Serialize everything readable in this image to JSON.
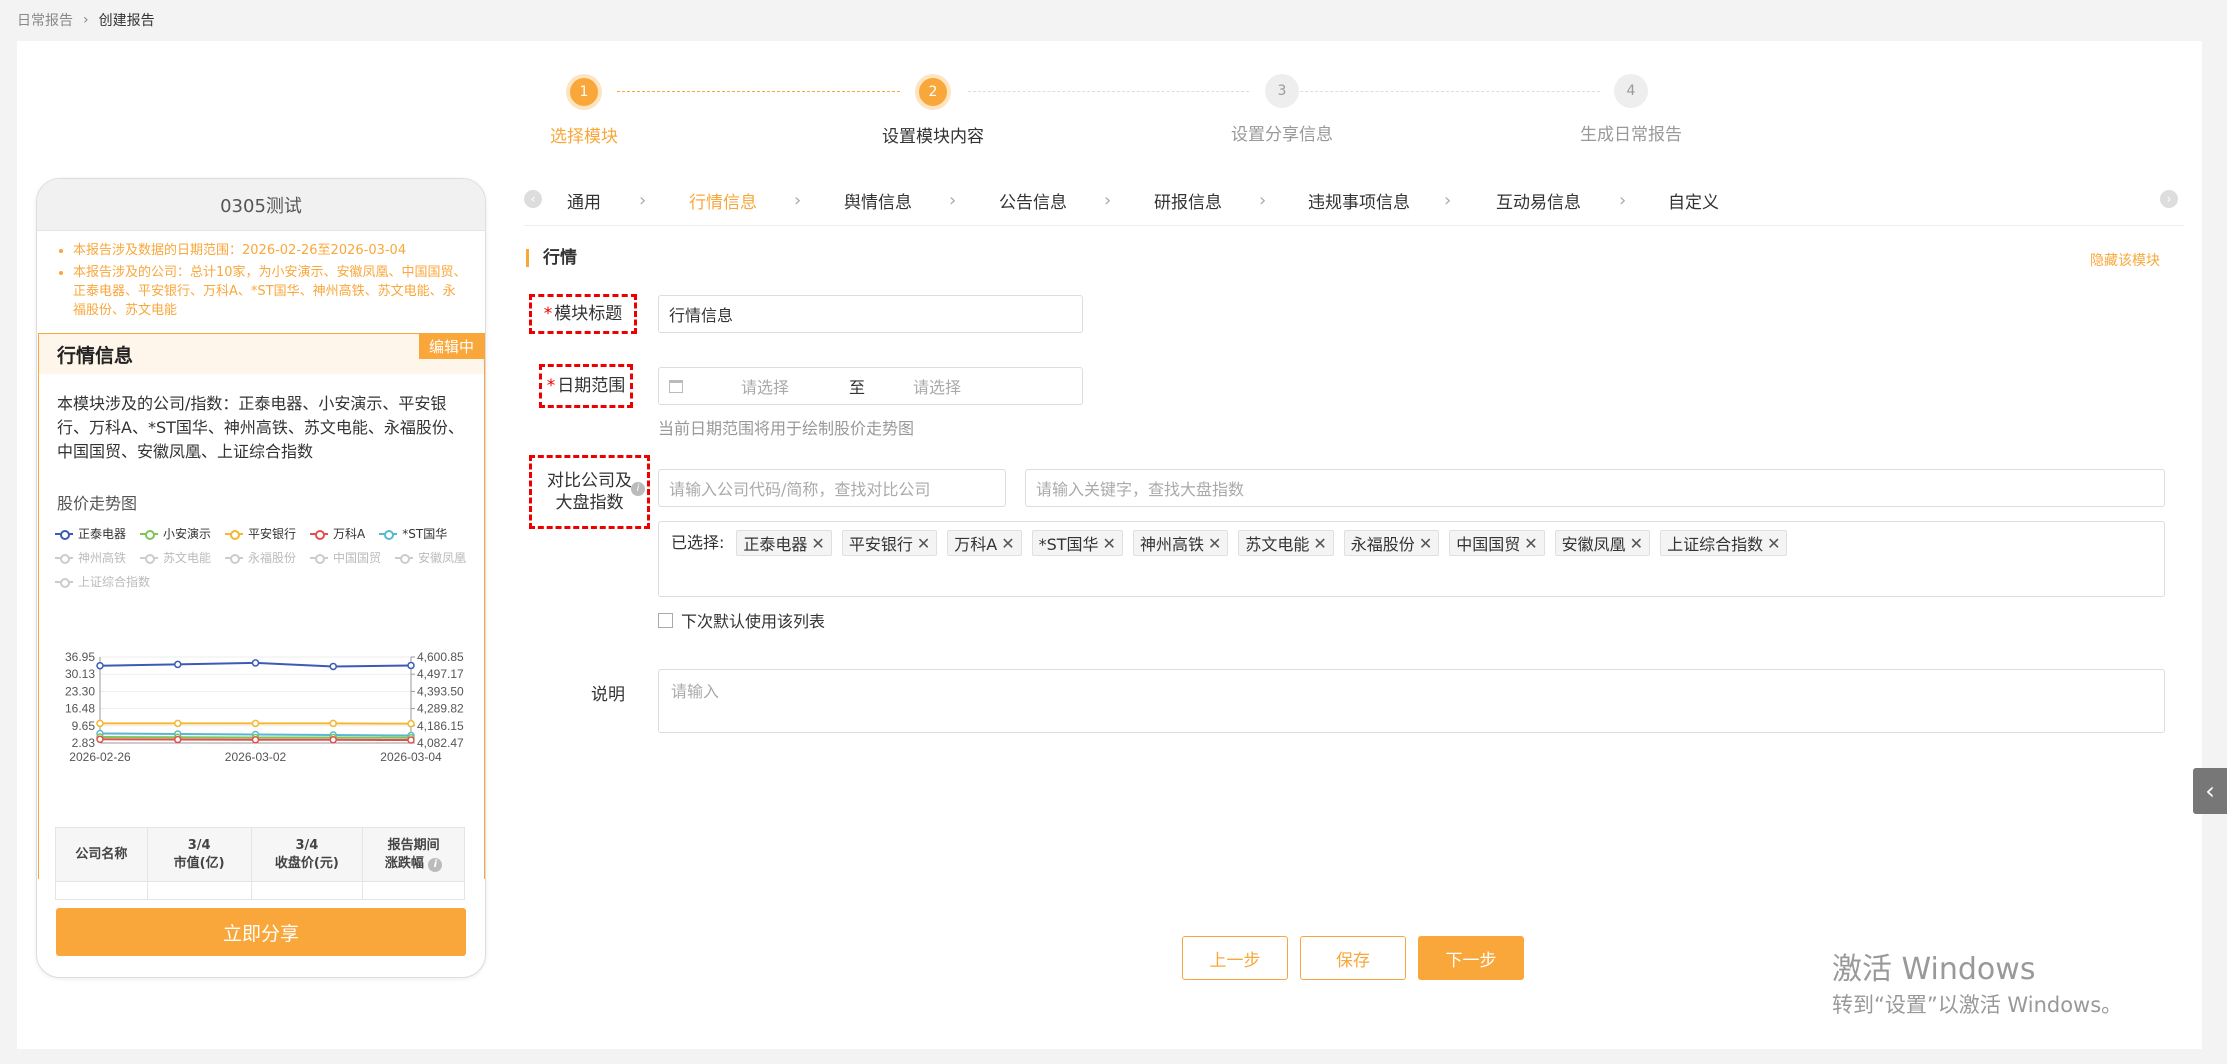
{
  "breadcrumb": {
    "home": "日常报告",
    "current": "创建报告"
  },
  "steps": [
    {
      "num": "1",
      "label": "选择模块"
    },
    {
      "num": "2",
      "label": "设置模块内容"
    },
    {
      "num": "3",
      "label": "设置分享信息"
    },
    {
      "num": "4",
      "label": "生成日常报告"
    }
  ],
  "preview": {
    "title": "0305测试",
    "notes": [
      "本报告涉及数据的日期范围：2026-02-26至2026-03-04",
      "本报告涉及的公司：总计10家，为小安演示、安徽凤凰、中国国贸、正泰电器、平安银行、万科A、*ST国华、神州高铁、苏文电能、永福股份、苏文电能"
    ],
    "module_title": "行情信息",
    "badge": "编辑中",
    "module_desc": "本模块涉及的公司/指数：正泰电器、小安演示、平安银行、万科A、*ST国华、神州高铁、苏文电能、永福股份、中国国贸、安徽凤凰、上证综合指数",
    "chart_title": "股价走势图",
    "legend_active": [
      {
        "name": "正泰电器",
        "color": "#3b5bb5"
      },
      {
        "name": "小安演示",
        "color": "#7fc45a"
      },
      {
        "name": "平安银行",
        "color": "#f5b731"
      },
      {
        "name": "万科A",
        "color": "#e2504e"
      },
      {
        "name": "*ST国华",
        "color": "#57b8d1"
      }
    ],
    "legend_inactive": [
      "神州高铁",
      "苏文电能",
      "永福股份",
      "中国国贸",
      "安徽凤凰",
      "上证综合指数"
    ],
    "table_headers": [
      "公司名称",
      "3/4\n市值(亿)",
      "3/4\n收盘价(元)",
      "报告期间\n涨跌幅"
    ],
    "share_label": "立即分享"
  },
  "chart_data": {
    "type": "line",
    "x": [
      "2026-02-26",
      "2026-02-27",
      "2026-03-02",
      "2026-03-03",
      "2026-03-04"
    ],
    "x_tick_labels": [
      "2026-02-26",
      "2026-03-02",
      "2026-03-04"
    ],
    "y_left_ticks": [
      "36.95",
      "30.13",
      "23.30",
      "16.48",
      "9.65",
      "2.83"
    ],
    "y_right_ticks": [
      "4,600.85",
      "4,497.17",
      "4,393.50",
      "4,289.82",
      "4,186.15",
      "4,082.47"
    ],
    "ylim": [
      2.83,
      36.95
    ],
    "grid": true,
    "series": [
      {
        "name": "正泰电器",
        "color": "#3b5bb5",
        "values": [
          33.5,
          34.0,
          34.6,
          33.2,
          33.6
        ]
      },
      {
        "name": "平安银行",
        "color": "#f5b731",
        "values": [
          10.6,
          10.6,
          10.6,
          10.6,
          10.5
        ]
      },
      {
        "name": "*ST国华",
        "color": "#57b8d1",
        "values": [
          6.6,
          6.4,
          6.2,
          6.0,
          5.8
        ]
      },
      {
        "name": "小安演示",
        "color": "#7fc45a",
        "values": [
          5.2,
          5.1,
          5.0,
          5.0,
          4.9
        ]
      },
      {
        "name": "万科A",
        "color": "#e2504e",
        "values": [
          4.3,
          4.2,
          4.1,
          4.1,
          4.0
        ]
      }
    ]
  },
  "tabs": [
    "通用",
    "行情信息",
    "舆情信息",
    "公告信息",
    "研报信息",
    "违规事项信息",
    "互动易信息",
    "自定义"
  ],
  "form": {
    "section_title": "行情",
    "hide_link": "隐藏该模块",
    "title_label": "模块标题",
    "title_value": "行情信息",
    "date_label": "日期范围",
    "date_start_placeholder": "请选择",
    "date_to": "至",
    "date_end_placeholder": "请选择",
    "date_hint": "当前日期范围将用于绘制股价走势图",
    "compare_label_1": "对比公司及",
    "compare_label_2": "大盘指数",
    "company_placeholder": "请输入公司代码/简称，查找对比公司",
    "index_placeholder": "请输入关键字，查找大盘指数",
    "selected_label": "已选择:",
    "selected": [
      "正泰电器",
      "平安银行",
      "万科A",
      "*ST国华",
      "神州高铁",
      "苏文电能",
      "永福股份",
      "中国国贸",
      "安徽凤凰",
      "上证综合指数"
    ],
    "default_checkbox": "下次默认使用该列表",
    "desc_label": "说明",
    "desc_placeholder": "请输入"
  },
  "buttons": {
    "prev": "上一步",
    "save": "保存",
    "next": "下一步"
  },
  "watermark": {
    "line1": "激活 Windows",
    "line2": "转到“设置”以激活 Windows。"
  }
}
